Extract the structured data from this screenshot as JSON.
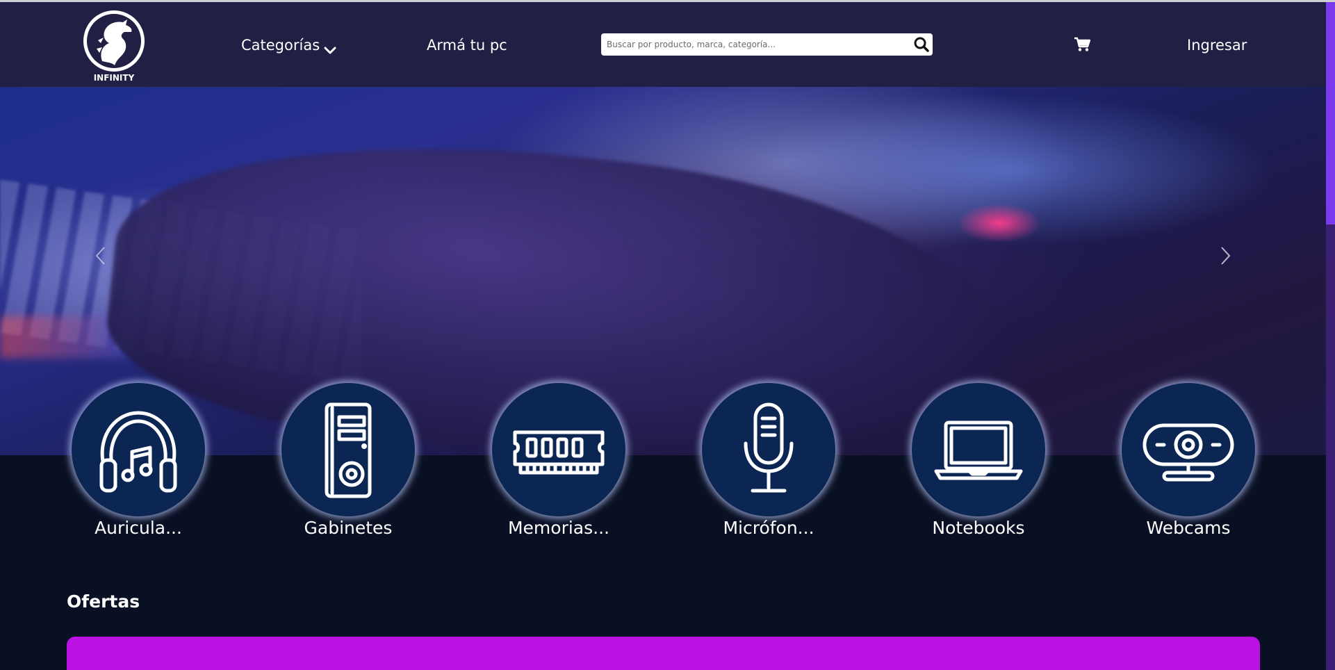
{
  "brand": {
    "name": "INFINITY"
  },
  "nav": {
    "categories_label": "Categorías",
    "build_pc_label": "Armá tu pc",
    "login_label": "Ingresar"
  },
  "search": {
    "placeholder": "Buscar por producto, marca, categoría..."
  },
  "icons": {
    "logo": "dragon-logo-icon",
    "categories_dropdown": "chevron-down-icon",
    "search": "search-icon",
    "cart": "shopping-cart-icon",
    "carousel_prev": "chevron-left-icon",
    "carousel_next": "chevron-right-icon"
  },
  "categories": [
    {
      "label": "Auricula...",
      "icon": "headphones-icon"
    },
    {
      "label": "Gabinetes",
      "icon": "pc-case-icon"
    },
    {
      "label": "Memorias...",
      "icon": "ram-memory-icon"
    },
    {
      "label": "Micrófon...",
      "icon": "microphone-icon"
    },
    {
      "label": "Notebooks",
      "icon": "laptop-icon"
    },
    {
      "label": "Webcams",
      "icon": "webcam-icon"
    }
  ],
  "offers": {
    "title": "Ofertas"
  },
  "colors": {
    "navbar": "#211f44",
    "page_background": "#0a1024",
    "category_circle": "#0c2653",
    "offers_panel": "#bb12e3",
    "scrollbar": "#7c3aed"
  }
}
